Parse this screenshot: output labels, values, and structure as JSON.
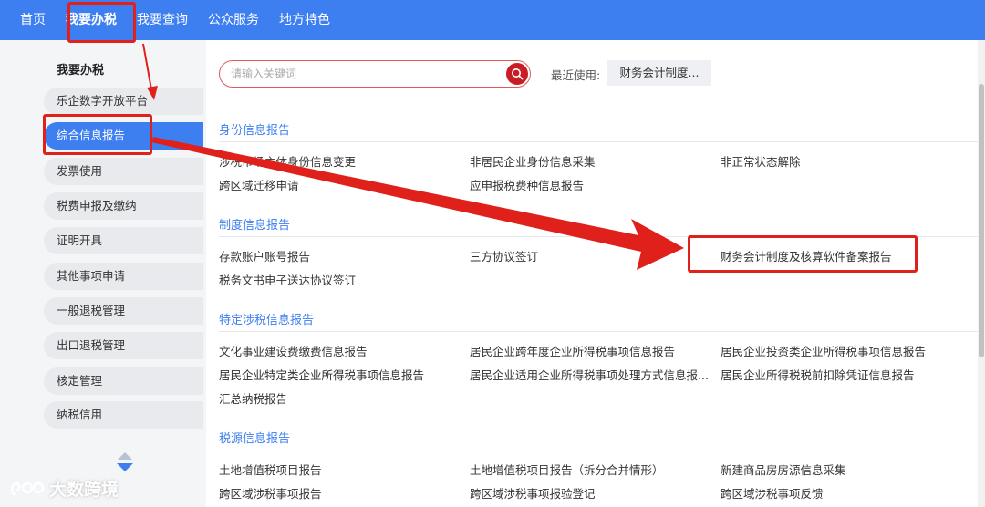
{
  "topnav": {
    "items": [
      "首页",
      "我要办税",
      "我要查询",
      "公众服务",
      "地方特色"
    ]
  },
  "sidebar": {
    "title": "我要办税",
    "items": [
      "乐企数字开放平台",
      "综合信息报告",
      "发票使用",
      "税费申报及缴纳",
      "证明开具",
      "其他事项申请",
      "一般退税管理",
      "出口退税管理",
      "核定管理",
      "纳税信用"
    ]
  },
  "search": {
    "placeholder": "请输入关键词",
    "value": ""
  },
  "recent": {
    "label": "最近使用:",
    "tag": "财务会计制度..."
  },
  "sections": [
    {
      "title": "身份信息报告",
      "links": [
        "涉税市场主体身份信息变更",
        "非居民企业身份信息采集",
        "非正常状态解除",
        "跨区域迁移申请",
        "应申报税费种信息报告"
      ]
    },
    {
      "title": "制度信息报告",
      "links": [
        "存款账户账号报告",
        "三方协议签订",
        "财务会计制度及核算软件备案报告",
        "税务文书电子送达协议签订"
      ]
    },
    {
      "title": "特定涉税信息报告",
      "links": [
        "文化事业建设费缴费信息报告",
        "居民企业跨年度企业所得税事项信息报告",
        "居民企业投资类企业所得税事项信息报告",
        "居民企业特定类企业所得税事项信息报告",
        "居民企业适用企业所得税事项处理方式信息报...",
        "居民企业所得税税前扣除凭证信息报告",
        "汇总纳税报告"
      ]
    },
    {
      "title": "税源信息报告",
      "links": [
        "土地增值税项目报告",
        "土地增值税项目报告（拆分合并情形）",
        "新建商品房房源信息采集",
        "跨区域涉税事项报告",
        "跨区域涉税事项报验登记",
        "跨区域涉税事项反馈"
      ]
    }
  ],
  "watermark": {
    "text": "大数跨境"
  },
  "colors": {
    "nav_blue": "#3d7ef0",
    "annotation_red": "#e0211b",
    "search_red": "#c81d24"
  }
}
